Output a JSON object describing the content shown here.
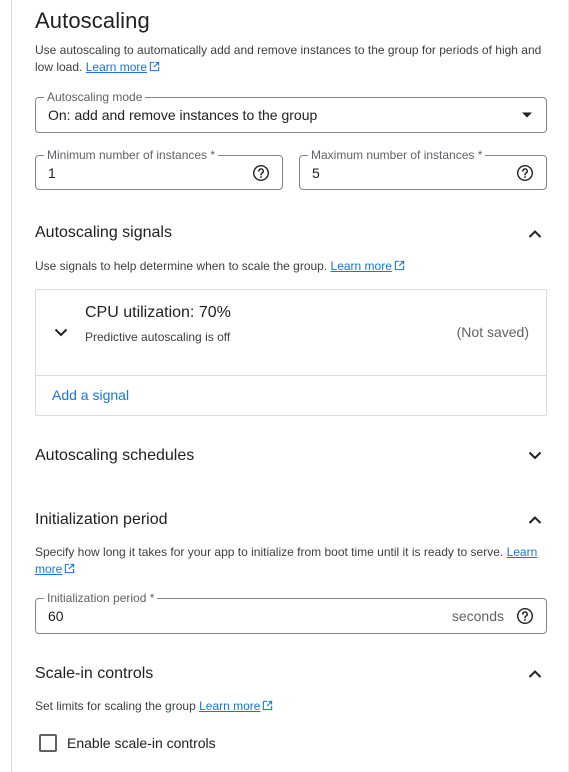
{
  "title": "Autoscaling",
  "intro": {
    "text": "Use autoscaling to automatically add and remove instances to the group for periods of high and low load.",
    "learn_more": "Learn more"
  },
  "mode": {
    "label": "Autoscaling mode",
    "value": "On: add and remove instances to the group"
  },
  "min_instances": {
    "label": "Minimum number of instances *",
    "value": "1"
  },
  "max_instances": {
    "label": "Maximum number of instances *",
    "value": "5"
  },
  "signals": {
    "heading": "Autoscaling signals",
    "desc": "Use signals to help determine when to scale the group.",
    "learn_more": "Learn more",
    "item": {
      "title": "CPU utilization: 70%",
      "subtitle": "Predictive autoscaling is off",
      "status": "(Not saved)"
    },
    "add_label": "Add a signal"
  },
  "schedules": {
    "heading": "Autoscaling schedules"
  },
  "init": {
    "heading": "Initialization period",
    "desc": "Specify how long it takes for your app to initialize from boot time until it is ready to serve.",
    "learn": "Learn",
    "more": "more",
    "field_label": "Initialization period *",
    "value": "60",
    "suffix": "seconds"
  },
  "scale_in": {
    "heading": "Scale-in controls",
    "desc": "Set limits for scaling the group",
    "learn_more": "Learn more",
    "checkbox_label": "Enable scale-in controls"
  },
  "colors": {
    "link": "#1a73e8",
    "text": "#202124",
    "secondary": "#5f6368",
    "border": "#dadce0"
  },
  "icons": [
    "external-link-icon",
    "help-icon",
    "chevron-up-icon",
    "chevron-down-icon",
    "dropdown-caret-icon",
    "checkbox-icon"
  ]
}
